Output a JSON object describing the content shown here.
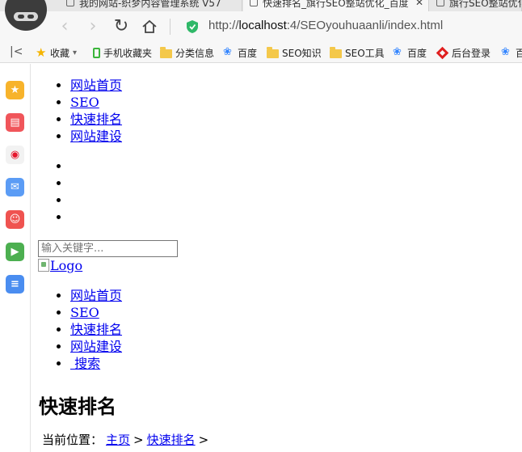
{
  "browser": {
    "tabs": [
      {
        "label": "我的网站-织梦内容管理系统 V57"
      },
      {
        "label": "快速排名_旗行SEO整站优化_百度",
        "close": "✕"
      },
      {
        "label": "旗行SEO整站优化"
      }
    ],
    "url_scheme": "http://",
    "url_host": "localhost",
    "url_path": ":4/SEOyouhuaanli/index.html",
    "bookmarks_toggle": "|<",
    "bookmarks": [
      {
        "label": "收藏",
        "icon": "star-icon"
      },
      {
        "label": "手机收藏夹",
        "icon": "phone-icon"
      },
      {
        "label": "分类信息",
        "icon": "folder-icon"
      },
      {
        "label": "百度",
        "icon": "paw-icon"
      },
      {
        "label": "SEO知识",
        "icon": "folder-icon"
      },
      {
        "label": "SEO工具",
        "icon": "folder-icon"
      },
      {
        "label": "百度",
        "icon": "paw-icon"
      },
      {
        "label": "后台登录",
        "icon": "diamond-icon"
      },
      {
        "label": "百",
        "icon": "paw-icon"
      }
    ]
  },
  "sidebar": {
    "icons": [
      {
        "name": "favorites-icon",
        "color": "#f7b32b",
        "glyph": "★"
      },
      {
        "name": "news-icon",
        "color": "#f0555a",
        "glyph": "▤"
      },
      {
        "name": "weibo-icon",
        "color": "#f2f2f2",
        "glyph": "◉"
      },
      {
        "name": "mail-icon",
        "color": "#5b9cf5",
        "glyph": "✉"
      },
      {
        "name": "game-icon",
        "color": "#ef5350",
        "glyph": "☺"
      },
      {
        "name": "tv-icon",
        "color": "#4caf50",
        "glyph": "▶"
      },
      {
        "name": "notes-icon",
        "color": "#4a8df0",
        "glyph": "≡"
      }
    ]
  },
  "page": {
    "top_nav": [
      "网站首页",
      "SEO",
      "快速排名",
      "网站建设"
    ],
    "empty_list_count": 4,
    "search_placeholder": "输入关键字...",
    "logo_alt": "Logo",
    "main_nav": [
      "网站首页",
      "SEO",
      "快速排名",
      "网站建设",
      " 搜索"
    ],
    "title": "快速排名",
    "breadcrumb": {
      "prefix": "当前位置：",
      "home": "主页",
      "sep1": ">",
      "current": "快速排名",
      "sep2": ">"
    }
  }
}
